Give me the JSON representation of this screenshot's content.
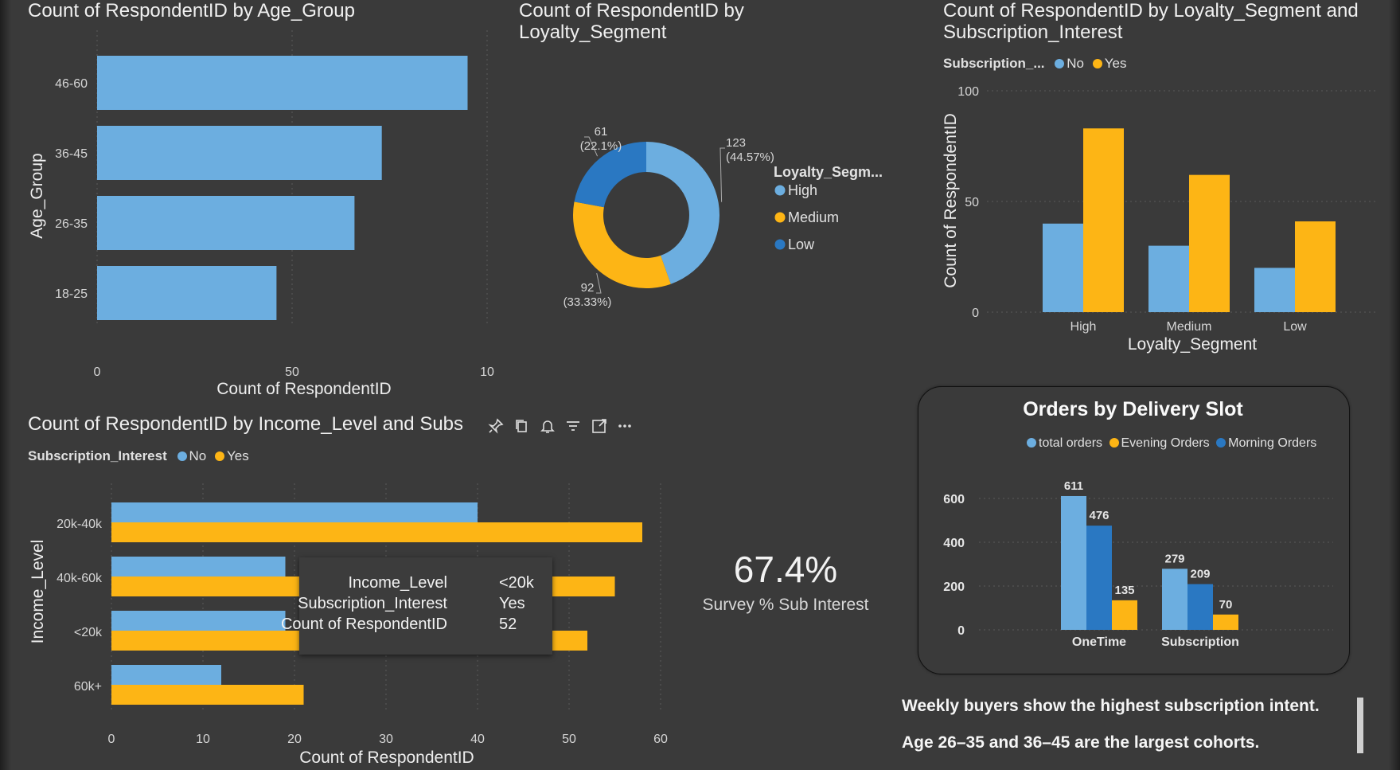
{
  "age_chart": {
    "title": "Count of RespondentID by Age_Group",
    "chart_data": {
      "type": "bar",
      "orientation": "horizontal",
      "title": "Count of RespondentID by Age_Group",
      "xlabel": "Count of RespondentID",
      "ylabel": "Age_Group",
      "categories": [
        "46-60",
        "36-45",
        "26-35",
        "18-25"
      ],
      "values": [
        95,
        73,
        66,
        46
      ],
      "x_ticks": [
        "0",
        "50",
        "10"
      ],
      "xlim": [
        0,
        100
      ],
      "color": "#6CAEE0"
    }
  },
  "loyalty_donut": {
    "title_line1": "Count of RespondentID by",
    "title_line2": "Loyalty_Segment",
    "legend_title": "Loyalty_Segm...",
    "chart_data": {
      "type": "pie",
      "variant": "donut",
      "categories": [
        "High",
        "Medium",
        "Low"
      ],
      "values": [
        123,
        92,
        61
      ],
      "percent_labels": [
        "(44.57%)",
        "(33.33%)",
        "(22.1%)"
      ],
      "value_labels": [
        "123",
        "92",
        "61"
      ],
      "colors": [
        "#6CAEE0",
        "#FDB515",
        "#2A78C2"
      ]
    }
  },
  "loyalty_sub_chart": {
    "title_line1": "Count of RespondentID by Loyalty_Segment and",
    "title_line2": "Subscription_Interest",
    "legend_title": "Subscription_...",
    "legend_no": "No",
    "legend_yes": "Yes",
    "chart_data": {
      "type": "bar",
      "xlabel": "Loyalty_Segment",
      "ylabel": "Count of RespondentID",
      "categories": [
        "High",
        "Medium",
        "Low"
      ],
      "series": [
        {
          "name": "No",
          "values": [
            40,
            30,
            20
          ],
          "color": "#6CAEE0"
        },
        {
          "name": "Yes",
          "values": [
            83,
            62,
            41
          ],
          "color": "#FDB515"
        }
      ],
      "y_ticks": [
        "100",
        "50",
        "0"
      ],
      "ylim": [
        0,
        100
      ]
    }
  },
  "income_chart": {
    "title": "Count of RespondentID by Income_Level and Subs",
    "legend_title": "Subscription_Interest",
    "legend_no": "No",
    "legend_yes": "Yes",
    "chart_data": {
      "type": "bar",
      "orientation": "horizontal",
      "xlabel": "Count of RespondentID",
      "ylabel": "Income_Level",
      "categories": [
        "20k-40k",
        "40k-60k",
        "<20k",
        "60k+"
      ],
      "series": [
        {
          "name": "No",
          "values": [
            40,
            19,
            19,
            12
          ],
          "color": "#6CAEE0"
        },
        {
          "name": "Yes",
          "values": [
            58,
            55,
            52,
            21
          ],
          "color": "#FDB515"
        }
      ],
      "x_ticks": [
        "0",
        "10",
        "20",
        "30",
        "40",
        "50",
        "60"
      ],
      "xlim": [
        0,
        60
      ]
    },
    "tooltip": {
      "rows": [
        {
          "key": "Income_Level",
          "value": "<20k"
        },
        {
          "key": "Subscription_Interest",
          "value": "Yes"
        },
        {
          "key": "Count of RespondentID",
          "value": "52"
        }
      ]
    },
    "toolbar_icons": [
      "pin-icon",
      "copy-icon",
      "bell-icon",
      "filter-icon",
      "focus-mode-icon",
      "more-options-icon"
    ]
  },
  "kpi": {
    "value": "67.4%",
    "label": "Survey % Sub Interest"
  },
  "delivery_chart": {
    "title": "Orders by Delivery Slot",
    "chart_data": {
      "type": "bar",
      "title": "Orders by Delivery Slot",
      "categories": [
        "OneTime",
        "Subscription"
      ],
      "series": [
        {
          "name": "total orders",
          "values": [
            611,
            279
          ],
          "color": "#6CAEE0"
        },
        {
          "name": "Morning Orders",
          "values": [
            476,
            209
          ],
          "color": "#2A78C2"
        },
        {
          "name": "Evening Orders",
          "values": [
            135,
            70
          ],
          "color": "#FDB515"
        }
      ],
      "legend_order": [
        "total orders",
        "Evening Orders",
        "Morning Orders"
      ],
      "y_ticks": [
        "600",
        "400",
        "200",
        "0"
      ],
      "ylim": [
        0,
        700
      ]
    }
  },
  "insights": {
    "line1": "Weekly buyers show the highest subscription intent.",
    "line2": "Age 26–35 and 36–45 are the largest cohorts."
  },
  "colors": {
    "background": "#3a3a3a",
    "no_light_blue": "#6CAEE0",
    "yes_yellow": "#FDB515",
    "dark_blue": "#2A78C2"
  }
}
